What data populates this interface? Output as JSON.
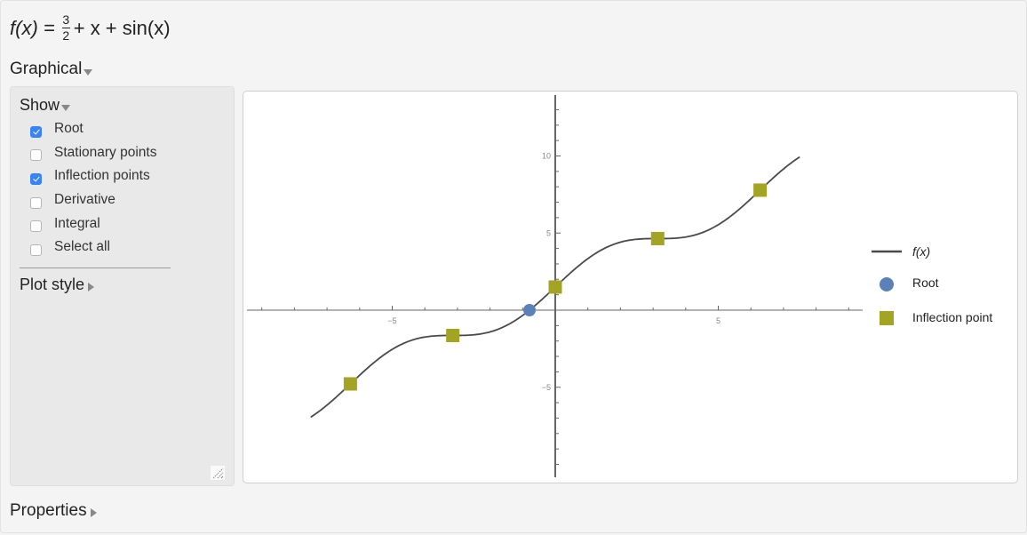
{
  "formula": {
    "lhs": "f(x) =",
    "frac_num": "3",
    "frac_den": "2",
    "rhs": "+ x + sin(x)"
  },
  "sections": {
    "graphical_label": "Graphical",
    "properties_label": "Properties"
  },
  "show_panel": {
    "title": "Show",
    "options": [
      {
        "label": "Root",
        "checked": true
      },
      {
        "label": "Stationary points",
        "checked": false
      },
      {
        "label": "Inflection points",
        "checked": true
      },
      {
        "label": "Derivative",
        "checked": false
      },
      {
        "label": "Integral",
        "checked": false
      },
      {
        "label": "Select all",
        "checked": false
      }
    ],
    "plot_style_label": "Plot style"
  },
  "colors": {
    "curve": "#4a4a4a",
    "root": "#5b82b8",
    "inflection": "#a3a424",
    "checkbox_accent": "#3a82f7"
  },
  "chart_data": {
    "type": "line",
    "title": "",
    "function": "3/2 + x + sin(x)",
    "x_range": [
      -7.5,
      7.5
    ],
    "xlim": [
      -9.3,
      9.6
    ],
    "ylim": [
      -10.9,
      13.9
    ],
    "x_ticks": [
      -5,
      5
    ],
    "y_ticks": [
      -5,
      5,
      10
    ],
    "x_tick_labels": [
      "-5",
      "5"
    ],
    "y_tick_labels": [
      "-5",
      "5",
      "10"
    ],
    "minor_tick_step": 1,
    "series": [
      {
        "name": "f(x)",
        "kind": "curve"
      },
      {
        "name": "Root",
        "kind": "points",
        "marker": "circle",
        "points": [
          [
            -0.79,
            0
          ]
        ]
      },
      {
        "name": "Inflection point",
        "kind": "points",
        "marker": "square",
        "points": [
          [
            -6.283,
            -4.783
          ],
          [
            -3.142,
            -1.642
          ],
          [
            0,
            1.5
          ],
          [
            3.142,
            4.642
          ],
          [
            6.283,
            7.783
          ]
        ]
      }
    ],
    "legend": [
      "f(x)",
      "Root",
      "Inflection point"
    ],
    "legend_position": "right"
  }
}
